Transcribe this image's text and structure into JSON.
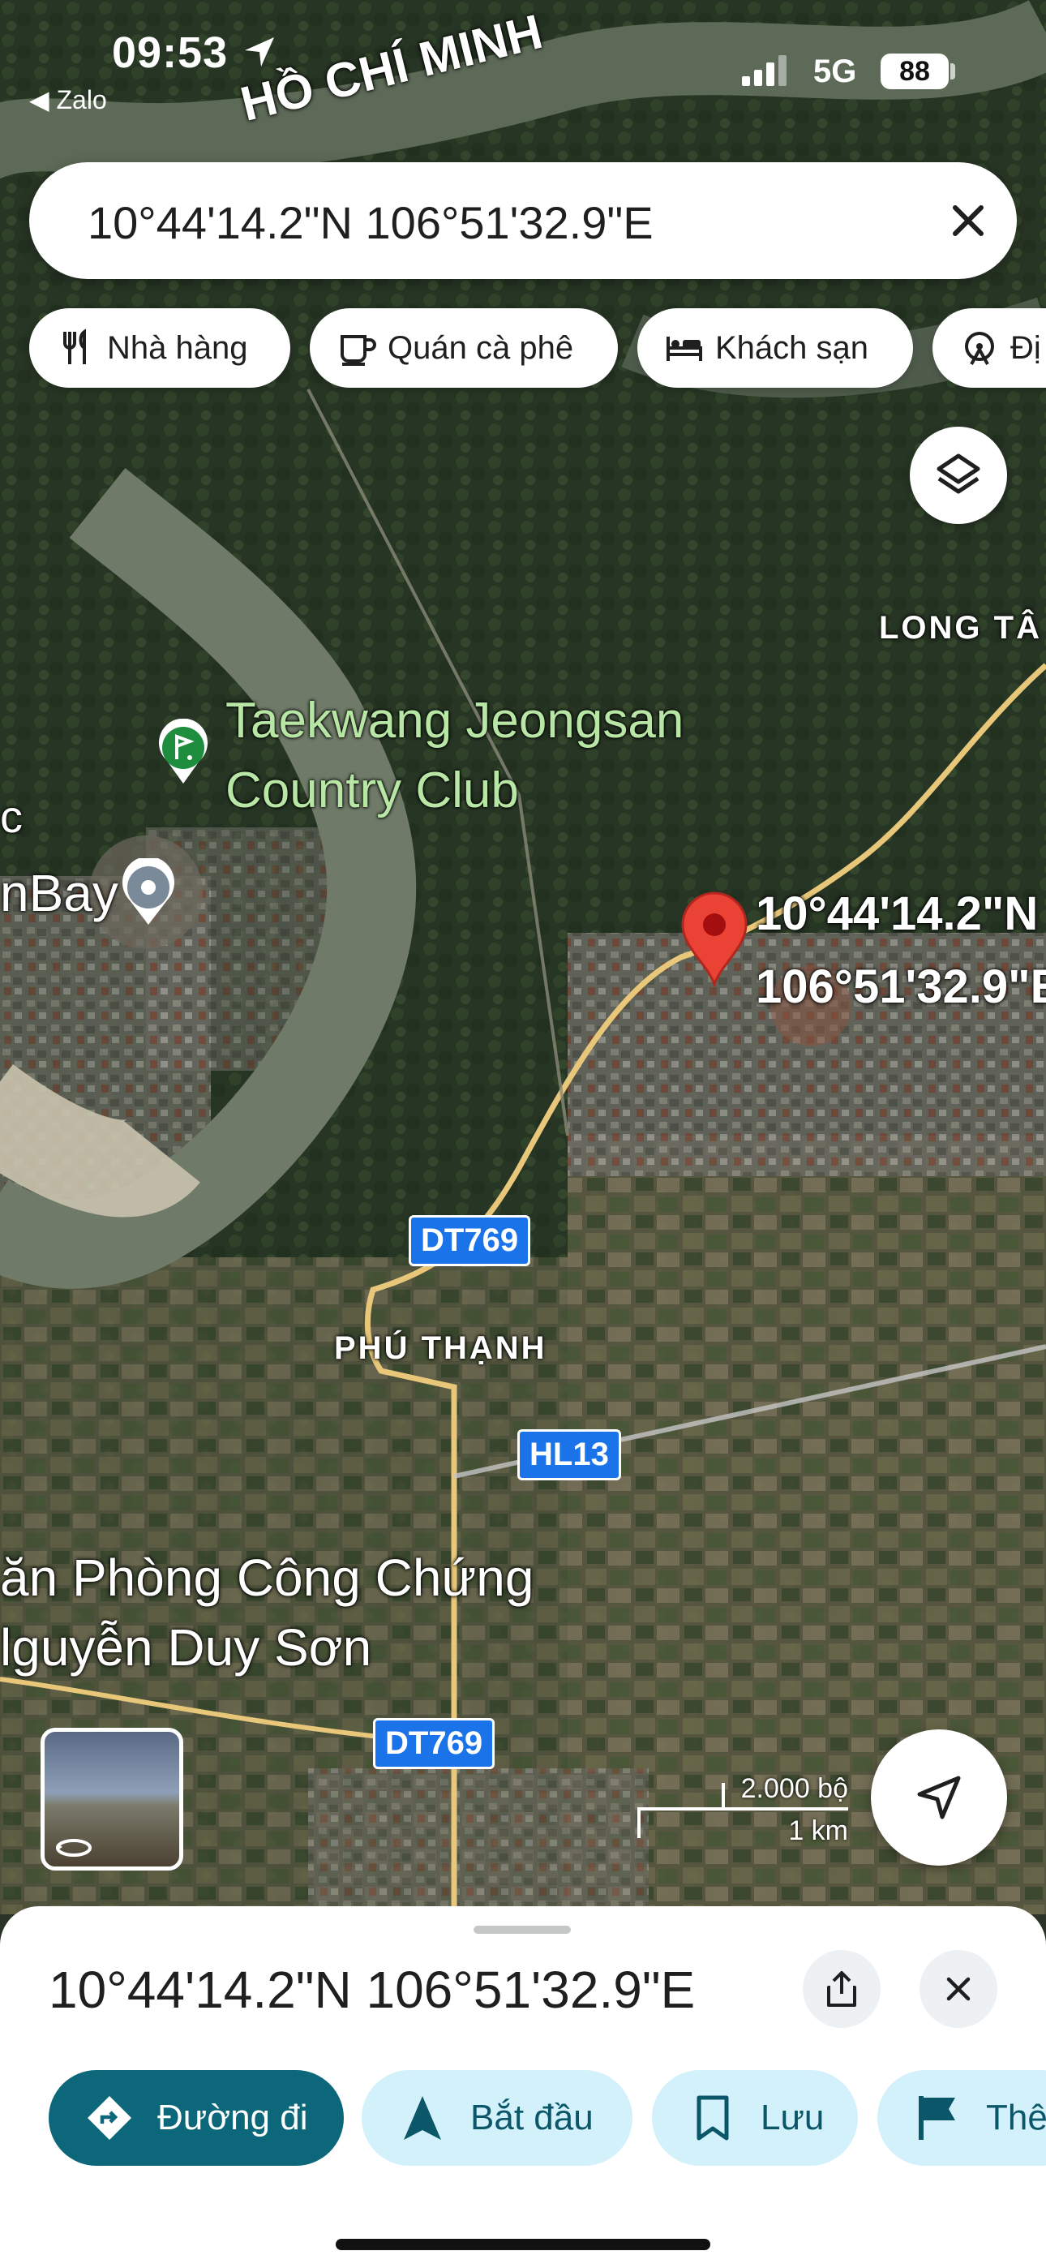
{
  "status_bar": {
    "time": "09:53",
    "back_app": "◀ Zalo",
    "network": "5G",
    "battery": "88"
  },
  "search": {
    "query": "10°44'14.2\"N 106°51'32.9\"E"
  },
  "chips": [
    {
      "label": "Nhà hàng",
      "icon": "fork-knife-icon"
    },
    {
      "label": "Quán cà phê",
      "icon": "coffee-icon"
    },
    {
      "label": "Khách sạn",
      "icon": "bed-icon"
    },
    {
      "label": "Đị",
      "icon": "attraction-icon"
    }
  ],
  "map": {
    "region_label": "HỒ CHÍ MINH",
    "area_labels": [
      "LONG TÂ",
      "PHÚ THẠNH"
    ],
    "places": {
      "club_line1": "Taekwang Jeongsan",
      "club_line2": "Country Club",
      "left_partial_1": "c",
      "left_partial_2": "nBay",
      "office_line1": "ăn Phòng Công Chứng",
      "office_line2": "lguyễn Duy Sơn"
    },
    "roads": [
      "DT769",
      "HL13",
      "DT769"
    ],
    "pin_label_line1": "10°44'14.2\"N",
    "pin_label_line2": "106°51'32.9\"E",
    "scale": {
      "top": "2.000 bộ",
      "bottom": "1 km"
    },
    "pin_color": "#ea4335",
    "road_color": "#e8c77a"
  },
  "sheet": {
    "title": "10°44'14.2\"N 106°51'32.9\"E",
    "actions": [
      {
        "label": "Đường đi",
        "icon": "directions-icon"
      },
      {
        "label": "Bắt đầu",
        "icon": "navigation-icon"
      },
      {
        "label": "Lưu",
        "icon": "bookmark-icon"
      },
      {
        "label": "Thê",
        "icon": "flag-icon"
      }
    ],
    "primary_color": "#0b6779",
    "secondary_color": "#d3f1fb"
  }
}
